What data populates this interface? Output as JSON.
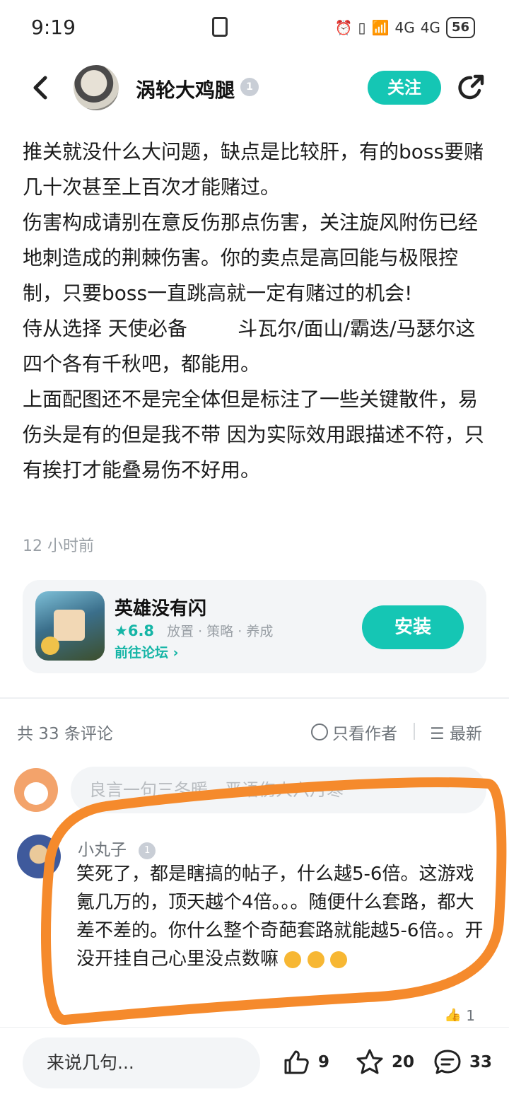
{
  "status_bar": {
    "time": "9:19",
    "network1": "4G",
    "network2": "4G",
    "battery": "56"
  },
  "header": {
    "username": "涡轮大鸡腿",
    "badge": "1",
    "follow_label": "关注"
  },
  "article": {
    "lines": [
      "推关就没什么大问题，缺点是比较肝，有的boss要赌几十次甚至上百次才能赌过。",
      "伤害构成请别在意反伤那点伤害，关注旋风附伤已经地刺造成的荆棘伤害。你的卖点是高回能与极限控制，只要boss一直跳高就一定有赌过的机会!",
      "侍从选择 天使必备        斗瓦尔/面山/霸迭/马瑟尔这四个各有千秋吧，都能用。",
      "上面配图还不是完全体但是标注了一些关键散件，易伤头是有的但是我不带  因为实际效用跟描述不符，只有挨打才能叠易伤不好用。"
    ],
    "time_ago": "12 小时前"
  },
  "game_card": {
    "name": "英雄没有闪",
    "rating": "★6.8",
    "tags": "放置 · 策略 · 养成",
    "forum_link": "前往论坛 ›",
    "install_label": "安装"
  },
  "comments": {
    "count_label": "共 33 条评论",
    "author_only": "只看作者",
    "sort_label": "最新",
    "input_placeholder": "良言一句三冬暖，恶语伤人六月寒",
    "items": [
      {
        "name": "小丸子",
        "badge": "1",
        "text": "笑死了，都是瞎搞的帖子，什么越5-6倍。这游戏氪几万的，顶天越个4倍。。。随便什么套路，都大差不差的。你什么整个奇葩套路就能越5-6倍。。开没开挂自己心里没点数嘛",
        "likes": "1"
      }
    ]
  },
  "bottom_bar": {
    "input_placeholder": "来说几句...",
    "likes": "9",
    "favorites": "20",
    "comments": "33"
  },
  "colors": {
    "accent": "#15c6b4",
    "annotation": "#f58a2c"
  }
}
